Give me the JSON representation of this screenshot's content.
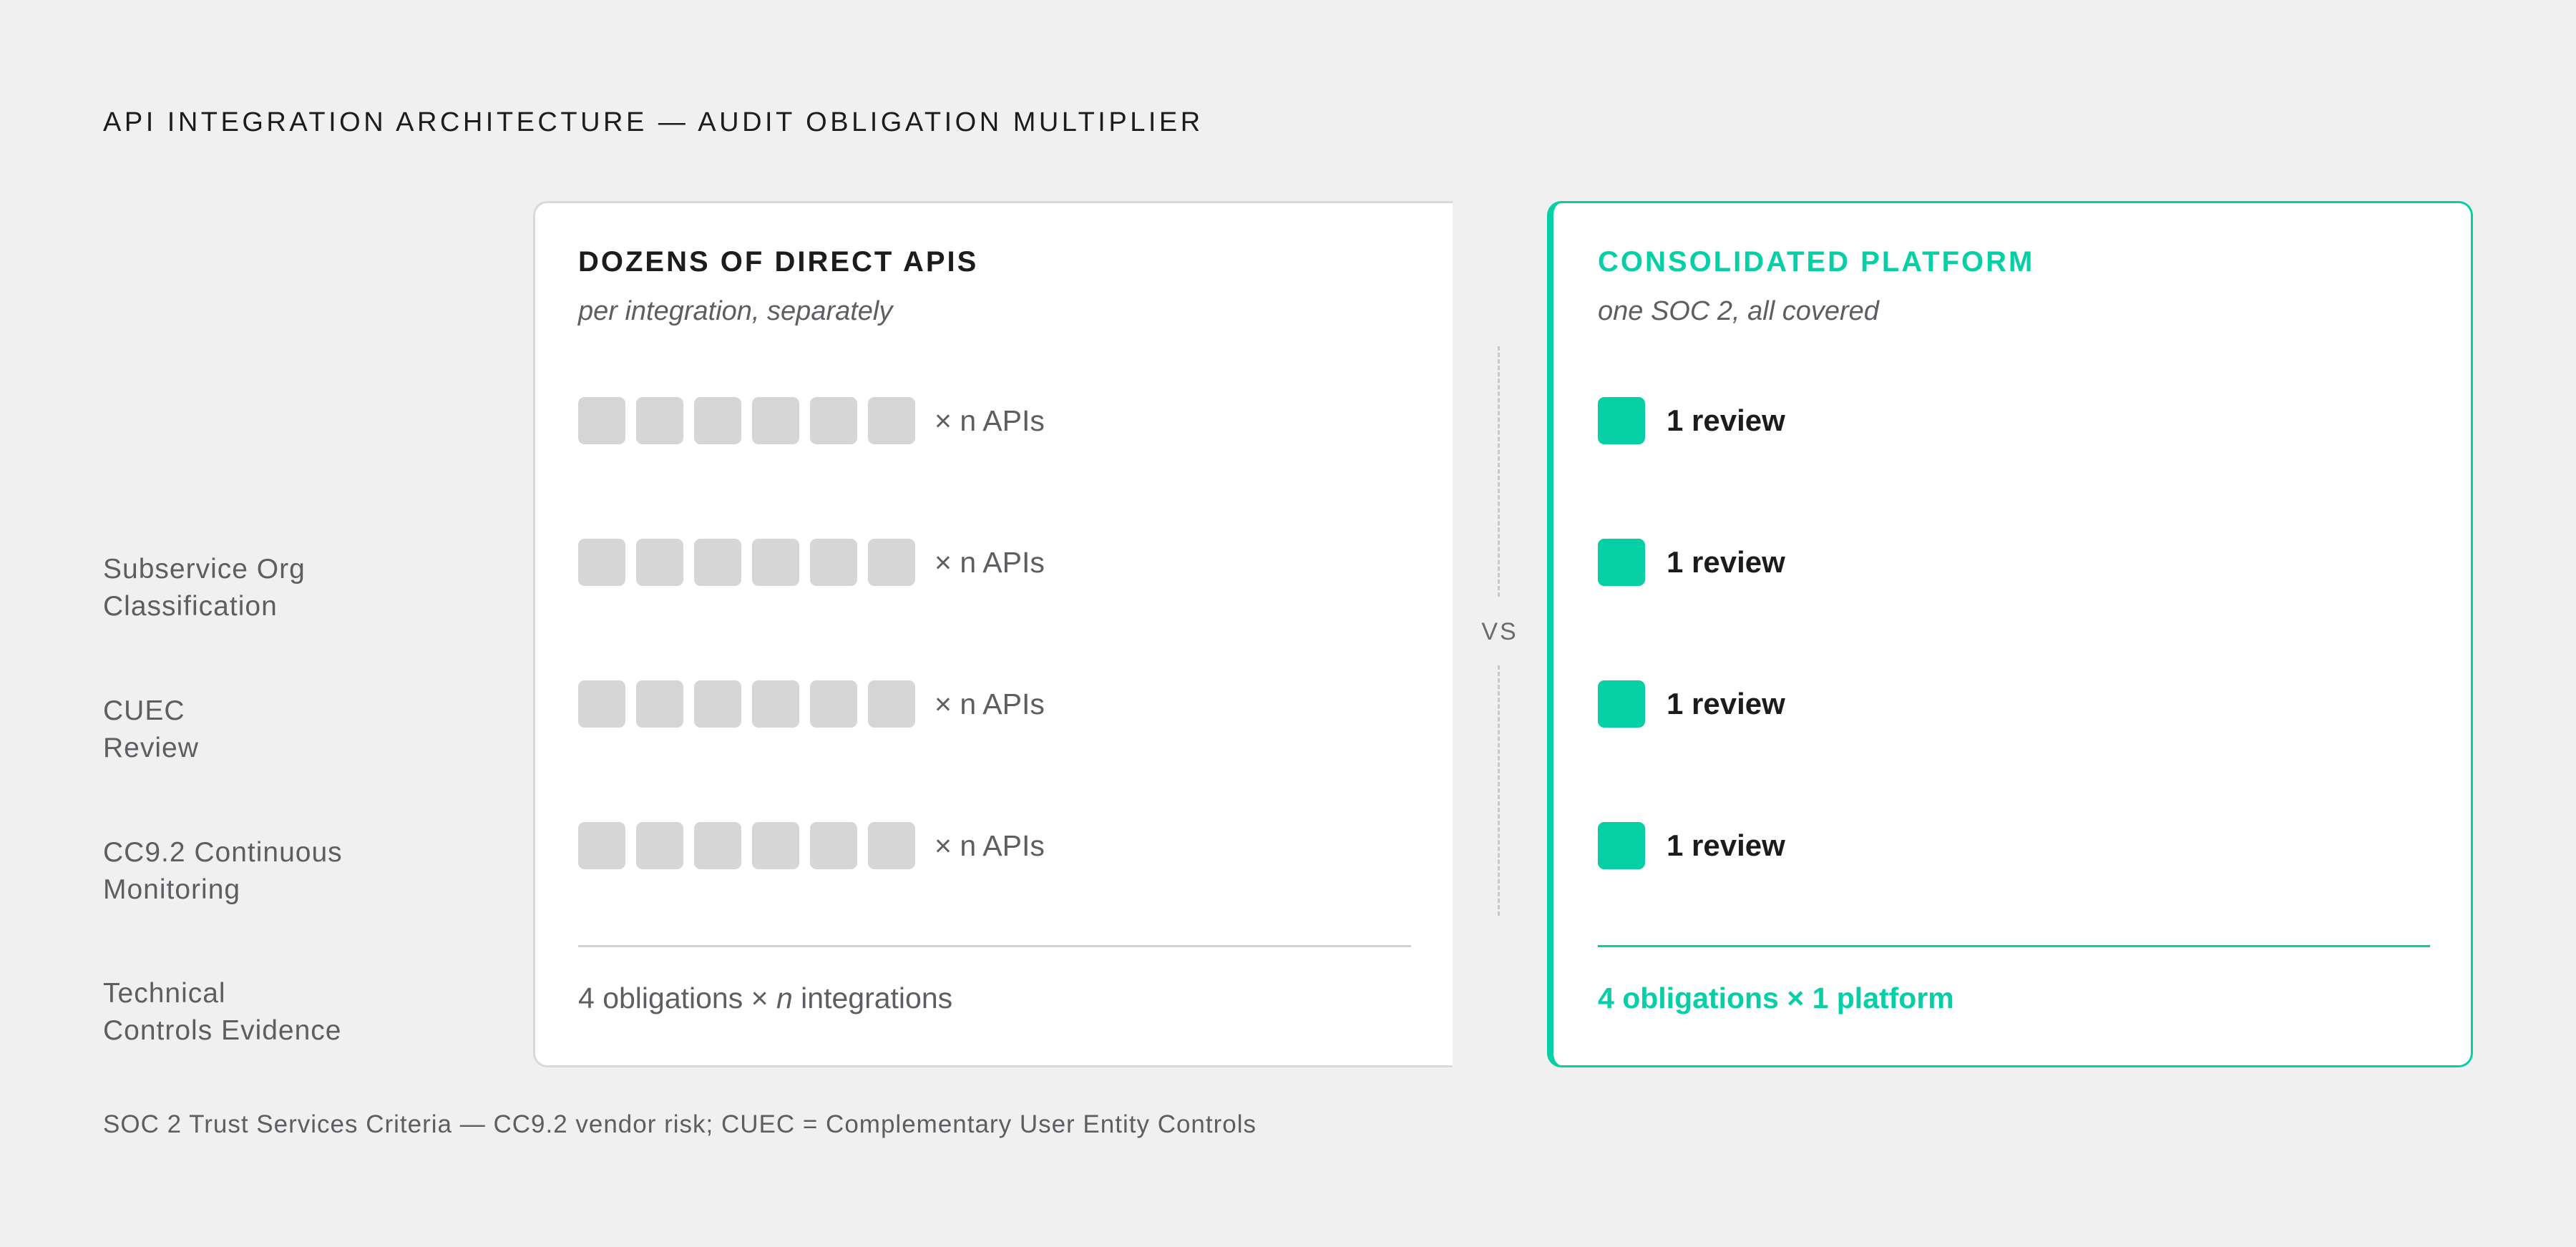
{
  "title": "API INTEGRATION ARCHITECTURE — AUDIT OBLIGATION MULTIPLIER",
  "row_labels": [
    {
      "line1": "Subservice Org",
      "line2": "Classification"
    },
    {
      "line1": "CUEC",
      "line2": "Review"
    },
    {
      "line1": "CC9.2 Continuous",
      "line2": "Monitoring"
    },
    {
      "line1": "Technical",
      "line2": "Controls Evidence"
    }
  ],
  "left_panel": {
    "title": "DOZENS OF DIRECT APIS",
    "subtitle": "per integration, separately",
    "row_text": [
      "× n APIs",
      "× n APIs",
      "× n APIs",
      "× n APIs"
    ],
    "boxes_per_row": 6,
    "summary": {
      "pre": "4 obligations × ",
      "n": "n",
      "post": " integrations"
    }
  },
  "vs_label": "VS",
  "right_panel": {
    "title": "CONSOLIDATED PLATFORM",
    "subtitle": "one SOC 2, all covered",
    "row_text": [
      "1 review",
      "1 review",
      "1 review",
      "1 review"
    ],
    "summary": "4 obligations × 1 platform"
  },
  "footnote": "SOC 2 Trust Services Criteria — CC9.2 vendor risk; CUEC = Complementary User Entity Controls",
  "colors": {
    "accent": "#06cfa5",
    "box_gray": "#d6d6d6",
    "background": "#f0f0f0",
    "text_dark": "#1c1c1e",
    "text_muted": "#5e5e62"
  }
}
